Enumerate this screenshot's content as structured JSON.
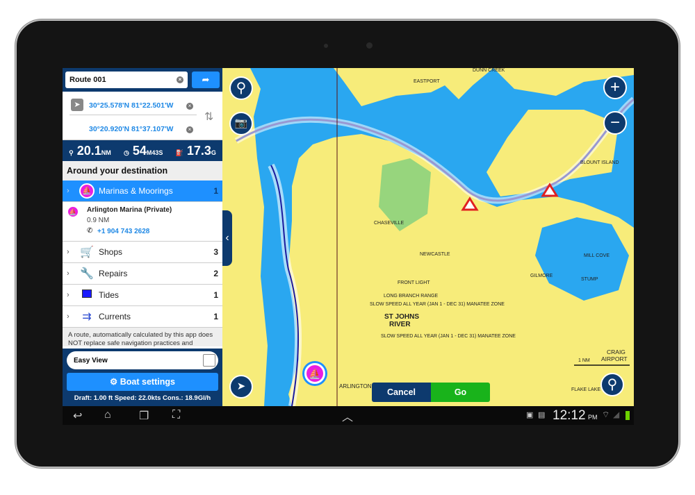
{
  "route": {
    "name": "Route 001",
    "start": "30°25.578'N 81°22.501'W",
    "end": "30°20.920'N 81°37.107'W"
  },
  "stats": {
    "distance": "20.1",
    "distance_unit": "NM",
    "time_min": "54",
    "time_min_unit": "M",
    "time_sec": "43",
    "time_sec_unit": "S",
    "fuel": "17.3",
    "fuel_unit": "G"
  },
  "around": {
    "title": "Around your destination",
    "categories": [
      {
        "label": "Marinas & Moorings",
        "count": "1",
        "icon": "marina-icon"
      },
      {
        "label": "Shops",
        "count": "3",
        "icon": "cart-icon"
      },
      {
        "label": "Repairs",
        "count": "2",
        "icon": "wrench-icon"
      },
      {
        "label": "Tides",
        "count": "1",
        "icon": "tides-icon"
      },
      {
        "label": "Currents",
        "count": "1",
        "icon": "currents-icon"
      }
    ],
    "marina": {
      "name": "Arlington Marina (Private)",
      "distance": "0.9 NM",
      "phone": "+1 904 743 2628"
    },
    "disclaimer": "A route, automatically calculated by this app does NOT replace safe navigation practices and"
  },
  "bottom": {
    "easy_view": "Easy View",
    "easy_view_checked": false,
    "boat_settings": "Boat settings",
    "boat_info": "Draft: 1.00 ft Speed: 22.0kts Cons.: 18.9Gl/h"
  },
  "map": {
    "labels": [
      "EASTPORT",
      "DUNN CREEK",
      "BLOUNT ISLAND",
      "CHASEVILLE",
      "NEWCASTLE",
      "GILMORE",
      "MILL COVE",
      "STUMP",
      "FRONT LIGHT",
      "LONG BRANCH RANGE",
      "SLOW SPEED ALL YEAR (JAN 1 - DEC 31) MANATEE ZONE",
      "SLOW SPEED ALL YEAR (JAN 1 - DEC 31) MANATEE ZONE",
      "ST JOHNS",
      "RIVER",
      "ARLINGTON",
      "FLAKE LAKE",
      "CRAIG",
      "AIRPORT"
    ],
    "scale": "1 NM",
    "cancel": "Cancel",
    "go": "Go"
  },
  "status": {
    "time": "12:12",
    "ampm": "PM"
  },
  "colors": {
    "navy": "#0d3a6e",
    "accent": "#1e90ff",
    "go": "#19b31b",
    "land": "#f7ec7a",
    "water": "#2aa7f0",
    "marina": "#e91ee0"
  }
}
